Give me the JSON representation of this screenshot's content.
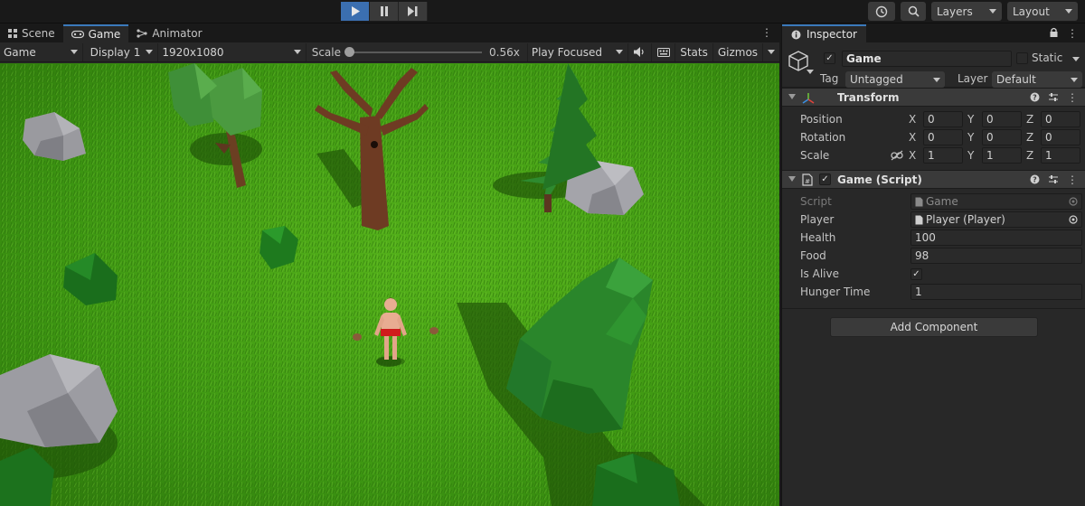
{
  "toolbar": {
    "layers_label": "Layers",
    "layout_label": "Layout"
  },
  "game_panel": {
    "tabs": [
      {
        "label": "Scene"
      },
      {
        "label": "Game"
      },
      {
        "label": "Animator"
      }
    ],
    "display_mode": "Game",
    "display": "Display 1",
    "resolution": "1920x1080",
    "scale_label": "Scale",
    "scale_value": "0.56x",
    "scale_fraction": 0.0,
    "play_mode": "Play Focused",
    "stats_label": "Stats",
    "gizmos_label": "Gizmos"
  },
  "inspector": {
    "tab_label": "Inspector",
    "object_name": "Game",
    "active": true,
    "static_label": "Static",
    "static": false,
    "tag_label": "Tag",
    "tag_value": "Untagged",
    "layer_label": "Layer",
    "layer_value": "Default",
    "transform": {
      "title": "Transform",
      "position_label": "Position",
      "rotation_label": "Rotation",
      "scale_label": "Scale",
      "axis_x": "X",
      "axis_y": "Y",
      "axis_z": "Z",
      "position": [
        "0",
        "0",
        "0"
      ],
      "rotation": [
        "0",
        "0",
        "0"
      ],
      "scale": [
        "1",
        "1",
        "1"
      ]
    },
    "script_component": {
      "title": "Game (Script)",
      "enabled": true,
      "script_label": "Script",
      "script_value": "Game",
      "player_label": "Player",
      "player_value": "Player (Player)",
      "health_label": "Health",
      "health_value": "100",
      "food_label": "Food",
      "food_value": "98",
      "is_alive_label": "Is Alive",
      "is_alive": true,
      "hunger_time_label": "Hunger Time",
      "hunger_time_value": "1"
    },
    "add_component_label": "Add Component"
  },
  "colors": {
    "accent": "#3b6fb0",
    "panel": "#282828",
    "grass": "#3f9a12"
  }
}
